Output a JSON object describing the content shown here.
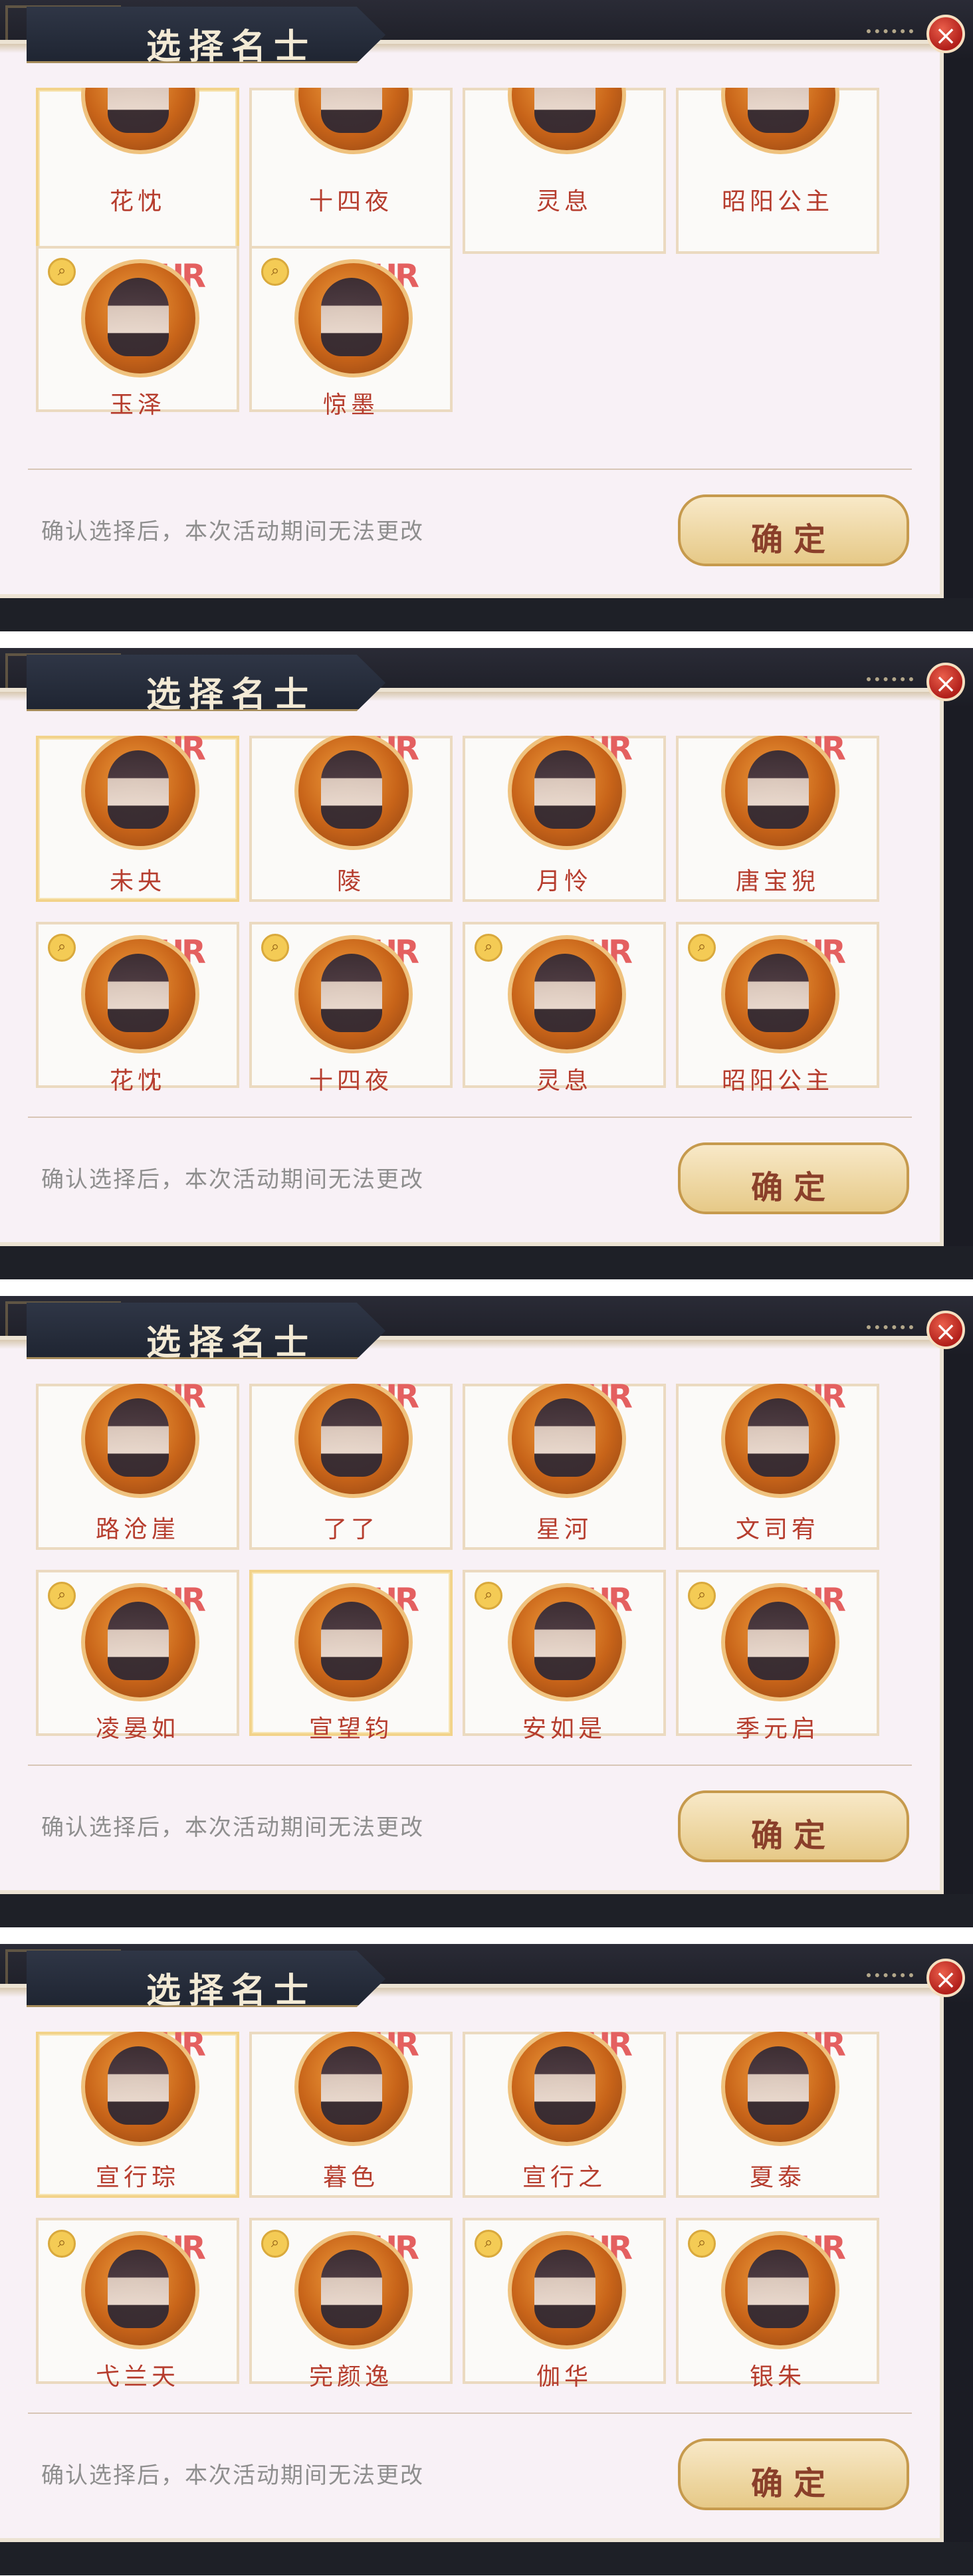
{
  "dialog_title": "选择名士",
  "close_symbol": "×",
  "notice": "确认选择后，本次活动期间无法更改",
  "confirm_label": "确定",
  "ur_badge": "UR",
  "panels": [
    {
      "top_names": [
        "花忱",
        "十四夜",
        "灵息",
        "昭阳公主"
      ],
      "bottom_names": [
        "玉泽",
        "惊墨",
        "",
        ""
      ]
    },
    {
      "top_names": [
        "未央",
        "陵",
        "月怜",
        "唐宝猊"
      ],
      "bottom_names": [
        "花忱",
        "十四夜",
        "灵息",
        "昭阳公主"
      ]
    },
    {
      "top_names": [
        "路沧崖",
        "了了",
        "星河",
        "文司宥"
      ],
      "bottom_names": [
        "凌晏如",
        "宣望钧",
        "安如是",
        "季元启"
      ]
    },
    {
      "top_names": [
        "宣行琮",
        "暮色",
        "宣行之",
        "夏泰"
      ],
      "bottom_names": [
        "弋兰天",
        "完颜逸",
        "伽华",
        "银朱"
      ]
    }
  ],
  "colors": {
    "name_text": "#b63d2e",
    "card_border": "#ebdac0",
    "selected_border": "#f2d38a",
    "close_red": "#b11f1a",
    "dialog_bg": "#f8f1f6",
    "header_dark": "#1f2532"
  }
}
